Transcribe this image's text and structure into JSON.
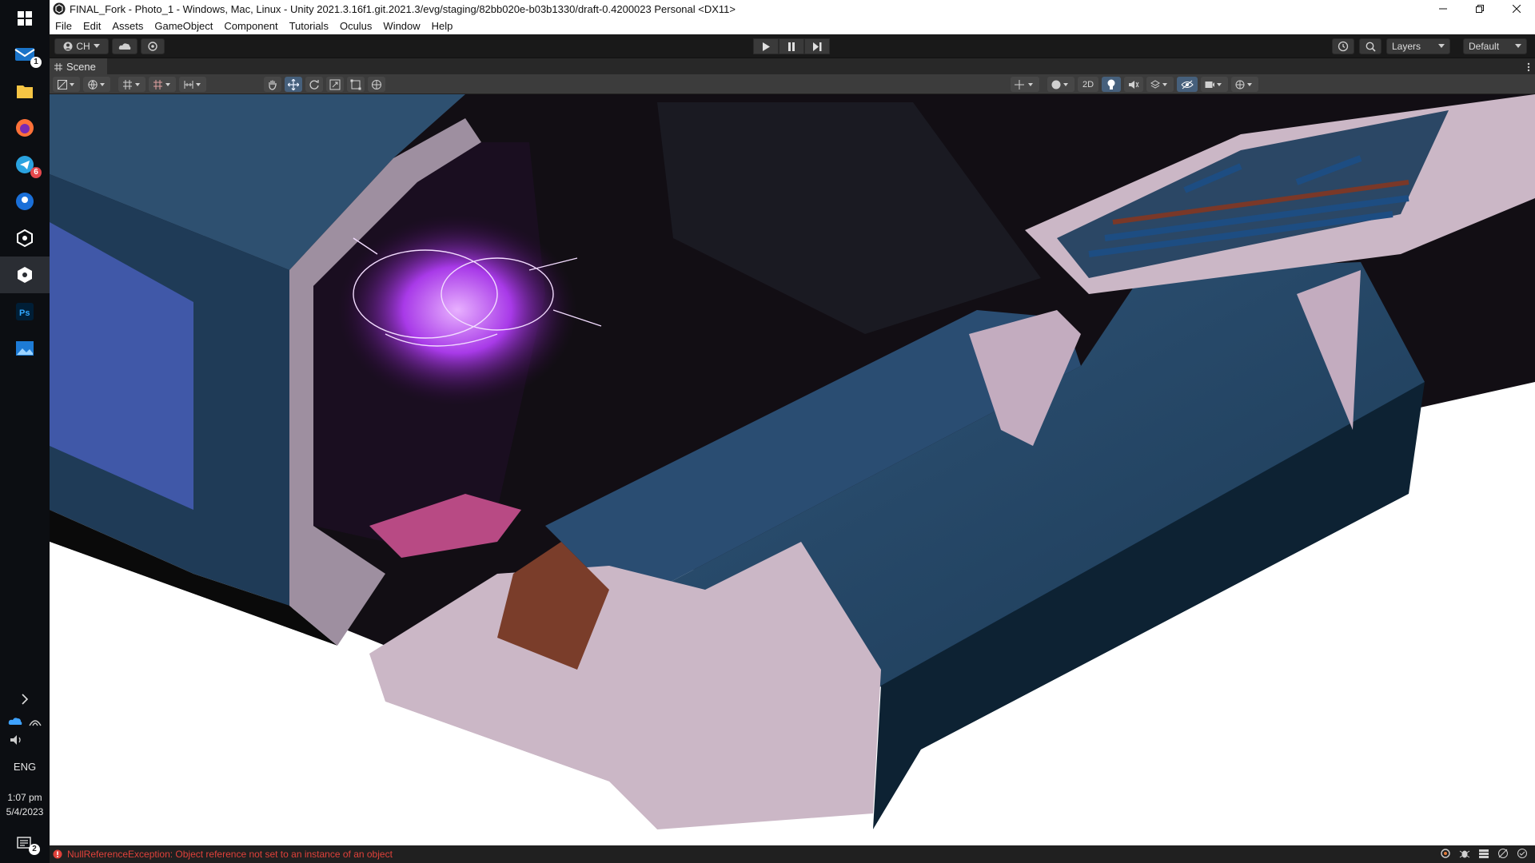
{
  "window": {
    "title": "FINAL_Fork - Photo_1 - Windows, Mac, Linux - Unity 2021.3.16f1.git.2021.3/evg/staging/82bb020e-b03b1330/draft-0.4200023 Personal <DX11>"
  },
  "menu": [
    "File",
    "Edit",
    "Assets",
    "GameObject",
    "Component",
    "Tutorials",
    "Oculus",
    "Window",
    "Help"
  ],
  "toolbar": {
    "account_label": "CH",
    "layers_label": "Layers",
    "layout_label": "Default"
  },
  "scene": {
    "tab_label": "Scene",
    "mode_2d_label": "2D"
  },
  "taskbar": {
    "mail_badge": "1",
    "telegram_badge": "6",
    "language": "ENG",
    "time": "1:07 pm",
    "date": "5/4/2023",
    "notifications_badge": "2"
  },
  "status": {
    "error_message": "NullReferenceException: Object reference not set to an instance of an object"
  },
  "colors": {
    "error": "#e0413a",
    "hull_blue": "#2b4a68",
    "trim_pink": "#c9b3c4",
    "portal_purple": "#a83ae8"
  }
}
